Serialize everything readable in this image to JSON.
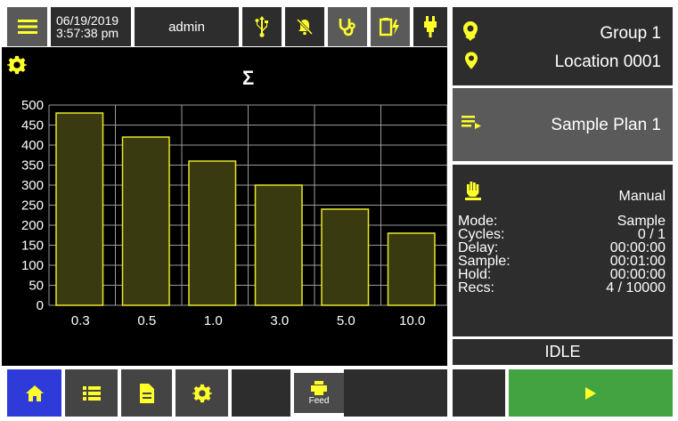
{
  "colors": {
    "accent": "#ffff2a",
    "panel": "#000000",
    "button_dark": "#2d2d2d",
    "button_mid": "#444444",
    "selected_blue": "#2f3bd9",
    "start_green": "#43a341",
    "bar_fill": "#3a3a10",
    "bar_stroke": "#e8e82b"
  },
  "header": {
    "date": "06/19/2019",
    "time": "3:57:38 pm",
    "user": "admin",
    "icons": [
      "menu-icon",
      "usb-icon",
      "bell-off-icon",
      "stethoscope-icon",
      "battery-charging-icon",
      "probe-icon"
    ]
  },
  "chart_header": {
    "symbol": "Σ"
  },
  "chart_data": {
    "type": "bar",
    "categories": [
      "0.3",
      "0.5",
      "1.0",
      "3.0",
      "5.0",
      "10.0"
    ],
    "values": [
      480,
      420,
      360,
      300,
      240,
      180
    ],
    "yticks": [
      "500",
      "450",
      "400",
      "350",
      "300",
      "250",
      "200",
      "150",
      "100",
      "50",
      "0"
    ],
    "ylim": [
      0,
      500
    ],
    "grid": true
  },
  "location": {
    "group": "Group 1",
    "location": "Location 0001"
  },
  "plan": {
    "name": "Sample Plan 1"
  },
  "status": {
    "mode_type": "Manual",
    "rows": [
      {
        "label": "Mode:",
        "value": "Sample"
      },
      {
        "label": "Cycles:",
        "value": "0 / 1"
      },
      {
        "label": "Delay:",
        "value": "00:00:00"
      },
      {
        "label": "Sample:",
        "value": "00:01:00"
      },
      {
        "label": "Hold:",
        "value": "00:00:00"
      },
      {
        "label": "Recs:",
        "value": "4 / 10000"
      }
    ],
    "state": "IDLE"
  },
  "footer": {
    "feed_label": "Feed"
  }
}
